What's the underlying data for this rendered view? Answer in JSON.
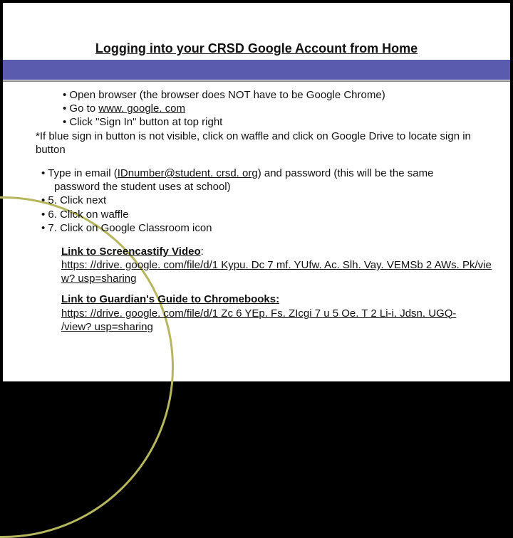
{
  "title": "Logging into your CRSD Google Account from Home",
  "steps1": {
    "b1": "Open browser (the browser does NOT have to be Google Chrome)",
    "b2_pre": "Go to ",
    "b2_link": "www. google. com",
    "b3": "Click \"Sign In\" button at top right",
    "note": "*If blue sign in button is not visible, click on waffle and click on Google Drive to locate sign in button"
  },
  "steps2": {
    "b1_pre": "Type in email (",
    "b1_link": "IDnumber@student. crsd. org",
    "b1_post": ") and password (this will be the same",
    "b1_cont": "password the student uses at school)",
    "b2": "5. Click next",
    "b3": "6. Click on waffle",
    "b4": "7. Click on Google Classroom icon"
  },
  "links": {
    "screencastify_label": "Link to Screencastify Video",
    "screencastify_url1": "https: //drive. google. com/file/d/1 Kypu. Dc 7 mf. YUfw. Ac. Slh. Vay. VEMSb 2 AWs. Pk/vie",
    "screencastify_url2": "w? usp=sharing",
    "guardian_label": "Link to Guardian's Guide to Chromebooks:",
    "guardian_url1": "https: //drive. google. com/file/d/1 Zc 6 YEp. Fs. ZIcgi 7 u 5 Oe. T 2 Li-i. Jdsn. UGQ-",
    "guardian_url2": "/view? usp=sharing"
  }
}
